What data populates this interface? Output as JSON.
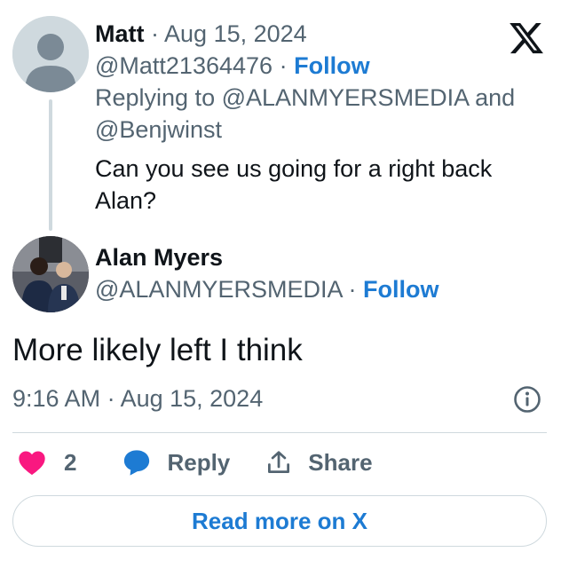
{
  "parent_tweet": {
    "author_name": "Matt",
    "separator": "·",
    "date": "Aug 15, 2024",
    "handle": "@Matt21364476",
    "follow_label": "Follow",
    "replying_prefix": "Replying to",
    "replying_user_1": "@ALANMYERSMEDIA",
    "replying_joiner": "and",
    "replying_user_2": "@Benjwinst",
    "text_line_1": "Can you see us going for a right back",
    "text_line_2": "Alan?"
  },
  "main_tweet": {
    "author_name": "Alan Myers",
    "handle": "@ALANMYERSMEDIA",
    "separator": "·",
    "follow_label": "Follow",
    "text": "More likely left I think",
    "timestamp": "9:16 AM · Aug 15, 2024",
    "like_count": "2",
    "reply_label": "Reply",
    "share_label": "Share"
  },
  "read_more_label": "Read more on X",
  "colors": {
    "link_blue": "#1d7bd3",
    "like_pink": "#f91880",
    "muted_text": "#536471",
    "border": "#cfd9de"
  },
  "icons": [
    "x-logo-icon",
    "default-avatar-icon",
    "info-icon",
    "heart-icon",
    "reply-bubble-icon",
    "share-icon"
  ]
}
